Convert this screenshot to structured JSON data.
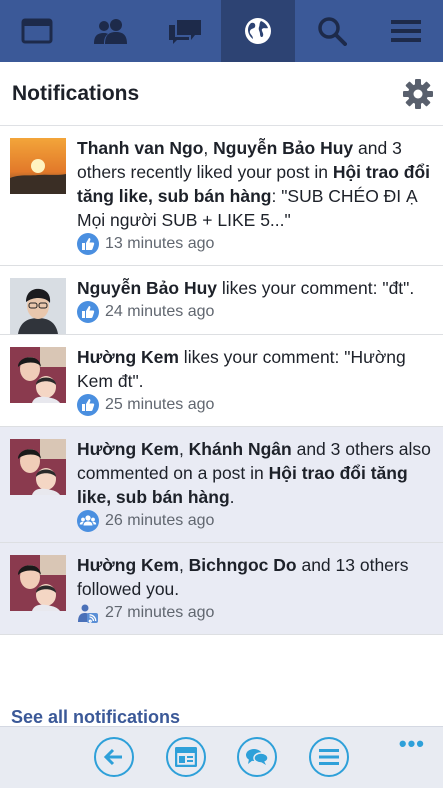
{
  "nav": {
    "tabs": [
      {
        "name": "news-feed-icon"
      },
      {
        "name": "friends-icon"
      },
      {
        "name": "messages-icon"
      },
      {
        "name": "globe-icon"
      },
      {
        "name": "search-icon"
      },
      {
        "name": "menu-icon"
      }
    ],
    "active_tab": "globe-icon"
  },
  "header": {
    "title": "Notifications",
    "settings_icon": "gear-icon"
  },
  "notifications": [
    {
      "parts": [
        {
          "t": "Thanh van Ngo",
          "b": true
        },
        {
          "t": ", ",
          "b": false
        },
        {
          "t": "Nguyễn Bảo Huy",
          "b": true
        },
        {
          "t": " and 3 others recently liked your post in ",
          "b": false
        },
        {
          "t": "Hội trao đổi tăng like, sub bán hàng",
          "b": true
        },
        {
          "t": ": \"SUB CHÉO ĐI Ạ Mọi người SUB + LIKE 5...\"",
          "b": false
        }
      ],
      "time": "13 minutes ago",
      "icon": "like-icon",
      "unread": false
    },
    {
      "parts": [
        {
          "t": "Nguyễn Bảo Huy",
          "b": true
        },
        {
          "t": " likes your comment: \"đt\".",
          "b": false
        }
      ],
      "time": "24 minutes ago",
      "icon": "like-icon",
      "unread": false
    },
    {
      "parts": [
        {
          "t": "Hường Kem",
          "b": true
        },
        {
          "t": " likes your comment: \"Hường Kem đt\".",
          "b": false
        }
      ],
      "time": "25 minutes ago",
      "icon": "like-icon",
      "unread": false
    },
    {
      "parts": [
        {
          "t": "Hường Kem",
          "b": true
        },
        {
          "t": ", ",
          "b": false
        },
        {
          "t": "Khánh Ngân",
          "b": true
        },
        {
          "t": " and 3 others also commented on a post in ",
          "b": false
        },
        {
          "t": "Hội trao đổi tăng like, sub bán hàng",
          "b": true
        },
        {
          "t": ".",
          "b": false
        }
      ],
      "time": "26 minutes ago",
      "icon": "group-icon",
      "unread": true
    },
    {
      "parts": [
        {
          "t": "Hường Kem",
          "b": true
        },
        {
          "t": ", ",
          "b": false
        },
        {
          "t": "Bichngoc Do",
          "b": true
        },
        {
          "t": " and 13 others followed you.",
          "b": false
        }
      ],
      "time": "27 minutes ago",
      "icon": "follow-icon",
      "unread": true
    }
  ],
  "footer": {
    "see_all": "See all notifications"
  },
  "appbar": {
    "buttons": [
      "back-icon",
      "news-icon",
      "chat-icon",
      "menu-icon"
    ],
    "more": "•••"
  },
  "colors": {
    "brand": "#3b5998",
    "accent": "#2ea0d9",
    "unread_bg": "#e9ebf4"
  }
}
